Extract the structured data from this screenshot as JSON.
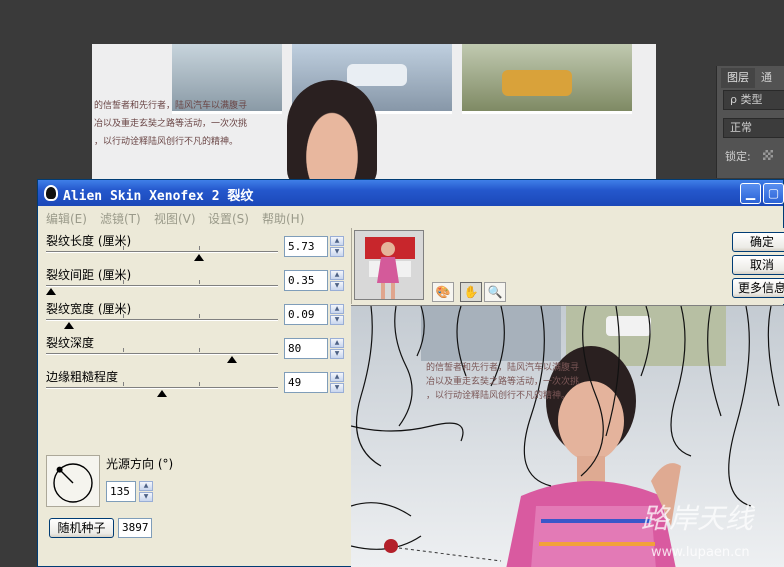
{
  "photoshop": {
    "doc_text_lines": [
      "的信誓者和先行者，陆风汽车以满腹寻",
      "冶以及重走玄奘之路等活动，一次次挑",
      "，以行动诠释陆风创行不凡的精神。"
    ],
    "panel": {
      "tabs": [
        "图层",
        "通道"
      ],
      "filter_label": "ρ 类型",
      "blend_mode": "正常",
      "lock_label": "锁定:"
    }
  },
  "window": {
    "title": "Alien Skin Xenofex 2 裂纹",
    "menu": [
      "编辑(E)",
      "滤镜(T)",
      "视图(V)",
      "设置(S)",
      "帮助(H)"
    ]
  },
  "params": [
    {
      "label": "裂纹长度 (厘米)",
      "value": "5.73",
      "level": 0.66
    },
    {
      "label": "裂纹间距 (厘米)",
      "value": "0.35",
      "level": 0.02
    },
    {
      "label": "裂纹宽度 (厘米)",
      "value": "0.09",
      "level": 0.1
    },
    {
      "label": "裂纹深度",
      "value": "80",
      "level": 0.8
    },
    {
      "label": "边缘粗糙程度",
      "value": "49",
      "level": 0.5
    }
  ],
  "light": {
    "label": "光源方向 (°)",
    "value": "135"
  },
  "seed": {
    "button": "随机种子",
    "value": "3897"
  },
  "actions": {
    "ok": "确定",
    "cancel": "取消",
    "more": "更多信息"
  },
  "doc_text_in_preview": [
    "的信誓者和先行者，陆风汽车以满腹寻",
    "冶以及重走玄奘之路等活动，一次次挑",
    "，以行动诠释陆风创行不凡的精神。"
  ],
  "watermark": {
    "cn": "路岸天线",
    "url": "www.lupaen.cn"
  }
}
